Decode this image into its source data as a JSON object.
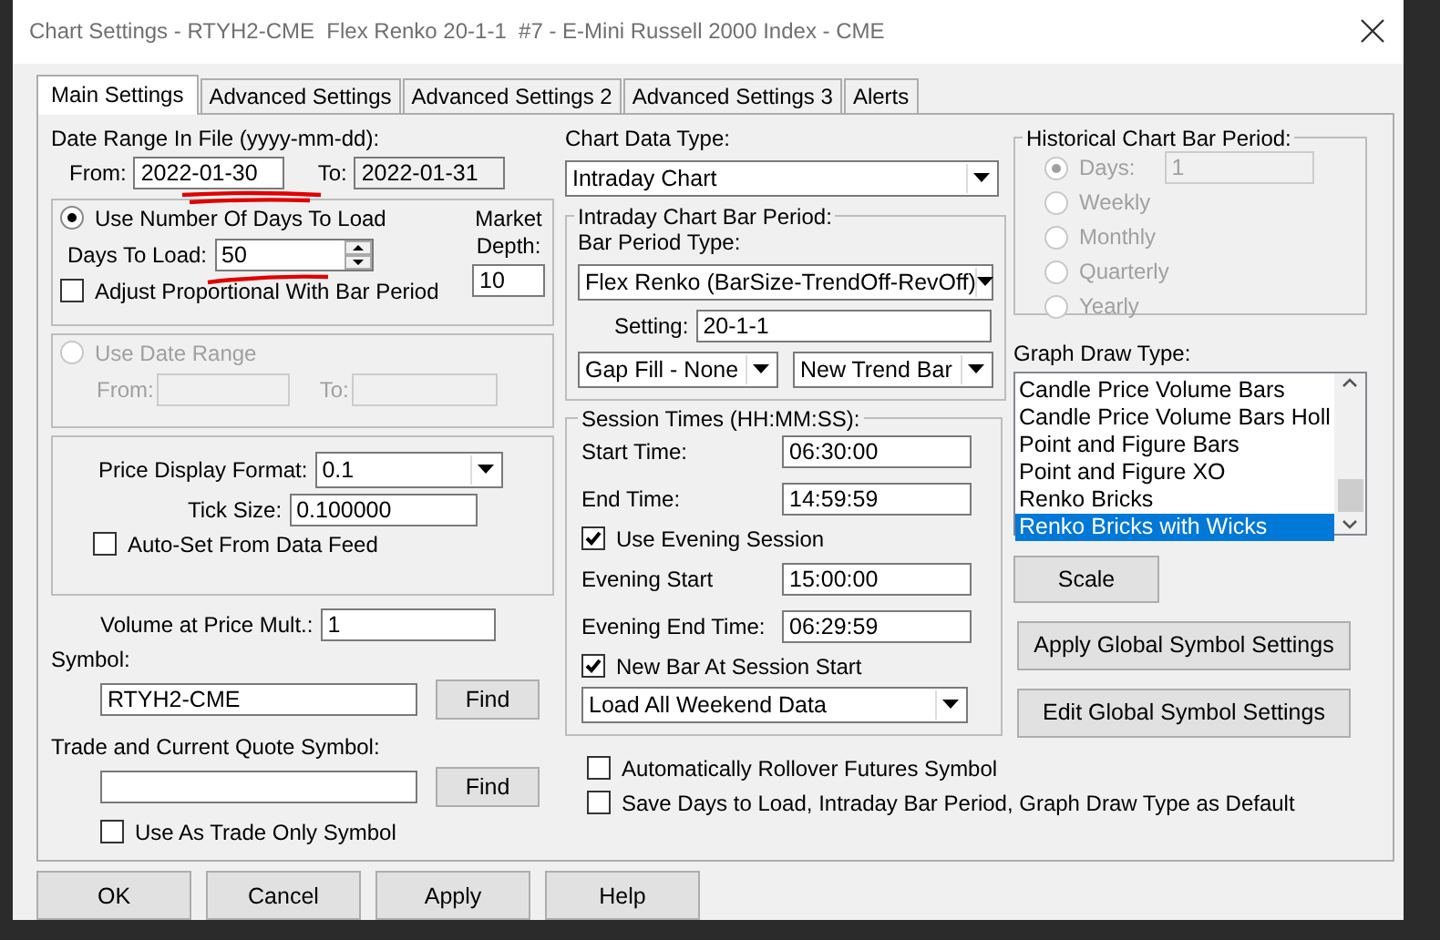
{
  "window": {
    "title": "Chart Settings - RTYH2-CME  Flex Renko 20-1-1  #7 - E-Mini Russell 2000 Index - CME"
  },
  "tabs": [
    {
      "label": "Main Settings",
      "selected": true
    },
    {
      "label": "Advanced Settings",
      "selected": false
    },
    {
      "label": "Advanced Settings 2",
      "selected": false
    },
    {
      "label": "Advanced Settings 3",
      "selected": false
    },
    {
      "label": "Alerts",
      "selected": false
    }
  ],
  "date_range": {
    "label": "Date Range In File (yyyy-mm-dd):",
    "from_label": "From:",
    "from_value": "2022-01-30",
    "from_marked": true,
    "to_label": "To:",
    "to_value": "2022-01-31"
  },
  "days_group": {
    "radio_label": "Use Number Of Days To Load",
    "selected": true,
    "days_label": "Days To Load:",
    "days_value": "50",
    "days_marked": true,
    "depth_label": "Market Depth:",
    "depth_value": "10",
    "adjust": {
      "label": "Adjust Proportional With Bar Period",
      "checked": false
    }
  },
  "date_range_group": {
    "radio_label": "Use Date Range",
    "selected": false,
    "disabled": true,
    "from_label": "From:",
    "to_label": "To:"
  },
  "price_group": {
    "format_label": "Price Display Format:",
    "format_value": "0.1",
    "tick_label": "Tick Size:",
    "tick_value": "0.100000",
    "auto_set": {
      "label": "Auto-Set From Data Feed",
      "checked": false
    }
  },
  "volume": {
    "label": "Volume at Price Mult.:",
    "value": "1"
  },
  "symbol": {
    "label": "Symbol:",
    "value": "RTYH2-CME",
    "button": "Find"
  },
  "trade_symbol": {
    "label": "Trade and Current Quote Symbol:",
    "button": "Find"
  },
  "trade_only": {
    "label": "Use As Trade Only Symbol",
    "checked": false
  },
  "chart_data_type": {
    "label": "Chart Data Type:",
    "value": "Intraday Chart"
  },
  "intraday_period": {
    "title": "Intraday Chart Bar Period:",
    "type_label": "Bar Period Type:",
    "type_value": "Flex Renko (BarSize-TrendOff-RevOff)",
    "setting_label": "Setting:",
    "setting_value": "20-1-1",
    "gap_fill": "Gap Fill - None",
    "new_trend": "New Trend Bar"
  },
  "session": {
    "title": "Session Times (HH:MM:SS):",
    "fields": [
      {
        "label": "Start Time:",
        "value": "06:30:00"
      },
      {
        "label": "End Time:",
        "value": "14:59:59"
      }
    ],
    "evening": {
      "label": "Use Evening Session",
      "checked": true
    },
    "evening_fields": [
      {
        "label": "Evening Start",
        "value": "15:00:00"
      },
      {
        "label": "Evening End Time:",
        "value": "06:29:59"
      }
    ],
    "new_bar": {
      "label": "New Bar At Session Start",
      "checked": true
    },
    "weekend": "Load All Weekend Data"
  },
  "bottom_checks": [
    {
      "label": "Automatically Rollover Futures Symbol",
      "checked": false
    },
    {
      "label": "Save Days to Load, Intraday Bar Period, Graph Draw Type as Default",
      "checked": false
    }
  ],
  "historical": {
    "title": "Historical Chart Bar Period:",
    "disabled": true,
    "days_value": "1",
    "options": [
      {
        "label": "Days:",
        "selected": true
      },
      {
        "label": "Weekly",
        "selected": false
      },
      {
        "label": "Monthly",
        "selected": false
      },
      {
        "label": "Quarterly",
        "selected": false
      },
      {
        "label": "Yearly",
        "selected": false
      }
    ]
  },
  "graph_draw": {
    "label": "Graph Draw Type:",
    "items": [
      {
        "label": "Candle Price Volume Bars",
        "selected": false
      },
      {
        "label": "Candle Price Volume Bars Holl",
        "selected": false
      },
      {
        "label": "Point and Figure Bars",
        "selected": false
      },
      {
        "label": "Point and Figure XO",
        "selected": false
      },
      {
        "label": "Renko Bricks",
        "selected": false
      },
      {
        "label": "Renko Bricks with Wicks",
        "selected": true
      }
    ]
  },
  "side_buttons": [
    "Scale",
    "Apply Global Symbol Settings",
    "Edit Global Symbol Settings"
  ],
  "dialog_buttons": [
    "OK",
    "Cancel",
    "Apply",
    "Help"
  ]
}
